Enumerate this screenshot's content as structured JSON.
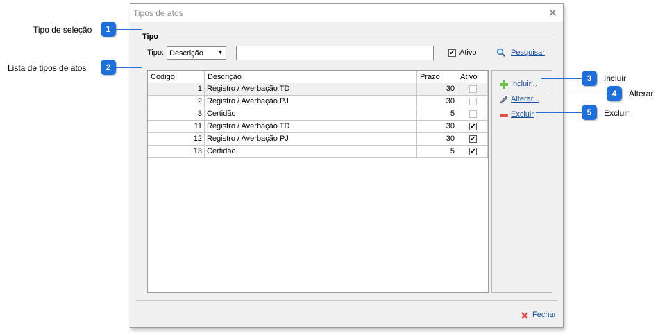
{
  "dialog": {
    "title": "Tipos de atos",
    "close_symbol": "✕",
    "group_title": "Tipo",
    "tipo_label": "Tipo:",
    "tipo_select_value": "Descrição",
    "search_text": "",
    "ativo_label": "Ativo",
    "ativo_checked": true,
    "search_button": "Pesquisar",
    "columns": [
      "Código",
      "Descrição",
      "Prazo",
      "Ativo"
    ],
    "rows": [
      {
        "codigo": "1",
        "descricao": "Registro / Averbação TD",
        "prazo": "30",
        "ativo": false
      },
      {
        "codigo": "2",
        "descricao": "Registro / Averbação PJ",
        "prazo": "30",
        "ativo": false
      },
      {
        "codigo": "3",
        "descricao": "Certidão",
        "prazo": "5",
        "ativo": false
      },
      {
        "codigo": "11",
        "descricao": "Registro / Averbação TD",
        "prazo": "30",
        "ativo": true
      },
      {
        "codigo": "12",
        "descricao": "Registro / Averbação PJ",
        "prazo": "30",
        "ativo": true
      },
      {
        "codigo": "13",
        "descricao": "Certidão",
        "prazo": "5",
        "ativo": true
      }
    ],
    "incluir": "Incluir...",
    "alterar": "Alterar...",
    "excluir": "Excluir",
    "fechar": "Fechar"
  },
  "annotations": [
    {
      "num": "1",
      "label": "Tipo de seleção"
    },
    {
      "num": "2",
      "label": "Lista de tipos de atos"
    },
    {
      "num": "3",
      "label": "Incluir"
    },
    {
      "num": "4",
      "label": "Alterar"
    },
    {
      "num": "5",
      "label": "Excluir"
    }
  ],
  "colors": {
    "callout": "#1e6fd9",
    "link": "#1a4fa0",
    "dialog_bg": "#f0f0f0"
  },
  "icons": [
    "search-icon",
    "add-icon",
    "edit-icon",
    "remove-icon",
    "close-icon",
    "checkmark-icon"
  ]
}
